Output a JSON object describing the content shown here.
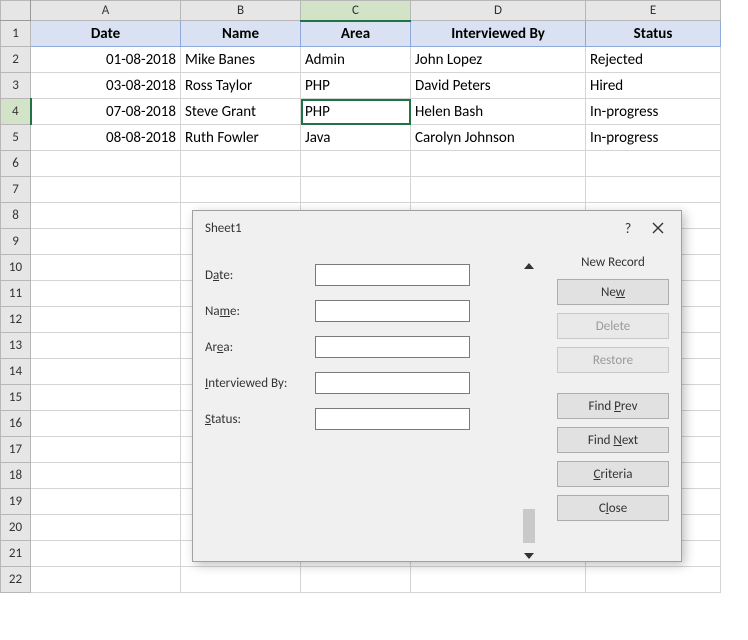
{
  "columns": {
    "A": "A",
    "B": "B",
    "C": "C",
    "D": "D",
    "E": "E"
  },
  "headers": {
    "A": "Date",
    "B": "Name",
    "C": "Area",
    "D": "Interviewed By",
    "E": "Status"
  },
  "rows": [
    {
      "date": "01-08-2018",
      "name": "Mike Banes",
      "area": "Admin",
      "interviewed": "John Lopez",
      "status": "Rejected"
    },
    {
      "date": "03-08-2018",
      "name": "Ross Taylor",
      "area": "PHP",
      "interviewed": "David Peters",
      "status": "Hired"
    },
    {
      "date": "07-08-2018",
      "name": "Steve Grant",
      "area": "PHP",
      "interviewed": "Helen Bash",
      "status": "In-progress"
    },
    {
      "date": "08-08-2018",
      "name": "Ruth Fowler",
      "area": "Java",
      "interviewed": "Carolyn Johnson",
      "status": "In-progress"
    }
  ],
  "selected_cell": "C4",
  "dialog": {
    "title": "Sheet1",
    "labels": {
      "date_pre": "D",
      "date_u": "a",
      "date_post": "te:",
      "name_pre": "Na",
      "name_u": "m",
      "name_post": "e:",
      "area_pre": "Ar",
      "area_u": "e",
      "area_post": "a:",
      "intv_pre": "",
      "intv_u": "I",
      "intv_post": "nterviewed By:",
      "status_pre": "",
      "status_u": "S",
      "status_post": "tatus:"
    },
    "values": {
      "date": "",
      "name": "",
      "area": "",
      "interviewed": "",
      "status": ""
    },
    "status_text": "New Record",
    "buttons": {
      "new_pre": "Ne",
      "new_u": "w",
      "new_post": "",
      "delete": "Delete",
      "restore": "Restore",
      "findprev_pre": "Find ",
      "findprev_u": "P",
      "findprev_post": "rev",
      "findnext_pre": "Find ",
      "findnext_u": "N",
      "findnext_post": "ext",
      "criteria_pre": "",
      "criteria_u": "C",
      "criteria_post": "riteria",
      "close_pre": "C",
      "close_u": "l",
      "close_post": "ose"
    },
    "help": "?"
  },
  "row_numbers": [
    "1",
    "2",
    "3",
    "4",
    "5",
    "6",
    "7",
    "8",
    "9",
    "10",
    "11",
    "12",
    "13",
    "14",
    "15",
    "16",
    "17",
    "18",
    "19",
    "20",
    "21",
    "22"
  ]
}
